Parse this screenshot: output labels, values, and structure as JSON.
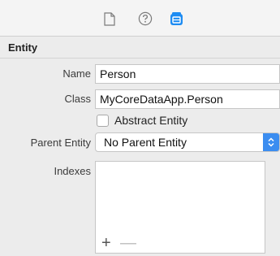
{
  "toolbar": {
    "buttons": [
      {
        "icon": "file-icon"
      },
      {
        "icon": "help-icon"
      },
      {
        "icon": "data-model-icon",
        "color": "#1e8cf2"
      }
    ]
  },
  "entity": {
    "section_title": "Entity",
    "name_label": "Name",
    "name_value": "Person",
    "class_label": "Class",
    "class_value": "MyCoreDataApp.Person",
    "abstract_label": "Abstract Entity",
    "abstract_checked": false,
    "parent_label": "Parent Entity",
    "parent_value": "No Parent Entity",
    "indexes_label": "Indexes",
    "add_symbol": "+",
    "remove_symbol": "—"
  },
  "colors": {
    "accent": "#3b8df0",
    "background": "#ececec"
  }
}
